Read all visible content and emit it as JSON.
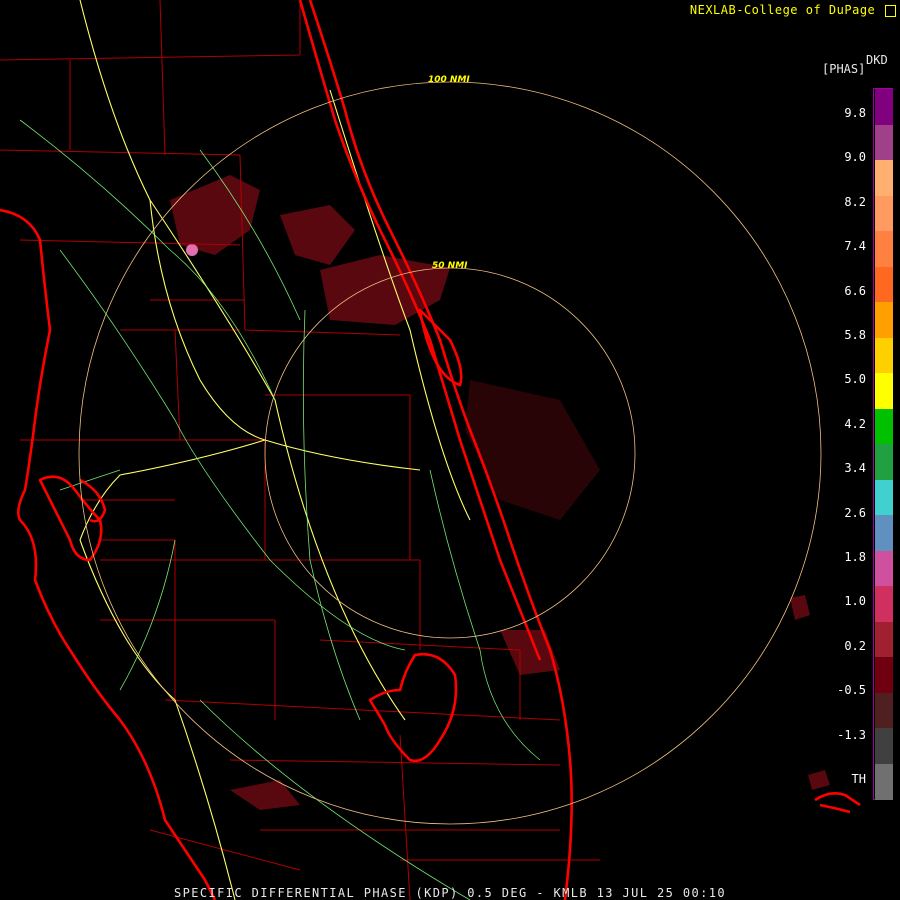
{
  "header": {
    "credit": "NEXLAB-College of DuPage"
  },
  "legend": {
    "product_code": "DKD",
    "unit": "[PHAS]",
    "ticks": [
      "9.8",
      "9.0",
      "8.2",
      "7.4",
      "6.6",
      "5.8",
      "5.0",
      "4.2",
      "3.4",
      "2.6",
      "1.8",
      "1.0",
      "0.2",
      "-0.5",
      "-1.3",
      "TH"
    ],
    "colors": [
      "#800080",
      "#a0408a",
      "#ffb070",
      "#ff9a60",
      "#ff8040",
      "#ff6820",
      "#ffa000",
      "#ffd000",
      "#ffff00",
      "#00c000",
      "#20a040",
      "#40d0d0",
      "#6090c0",
      "#d050a0",
      "#d03060",
      "#a02030",
      "#700010",
      "#502020",
      "#404040",
      "#707070"
    ]
  },
  "rings": {
    "inner_label": "50 NMI",
    "outer_label": "100 NMI"
  },
  "footer": {
    "caption": "SPECIFIC DIFFERENTIAL PHASE (KDP) 0.5 DEG - KMLB 13 JUL 25 00:10"
  },
  "colors": {
    "background": "#000000",
    "coastline": "#ff0000",
    "county": "#b00000",
    "highway": "#ffff66",
    "road": "#80ff80",
    "echo": "#6a0a14",
    "ring": "#f0c080"
  }
}
